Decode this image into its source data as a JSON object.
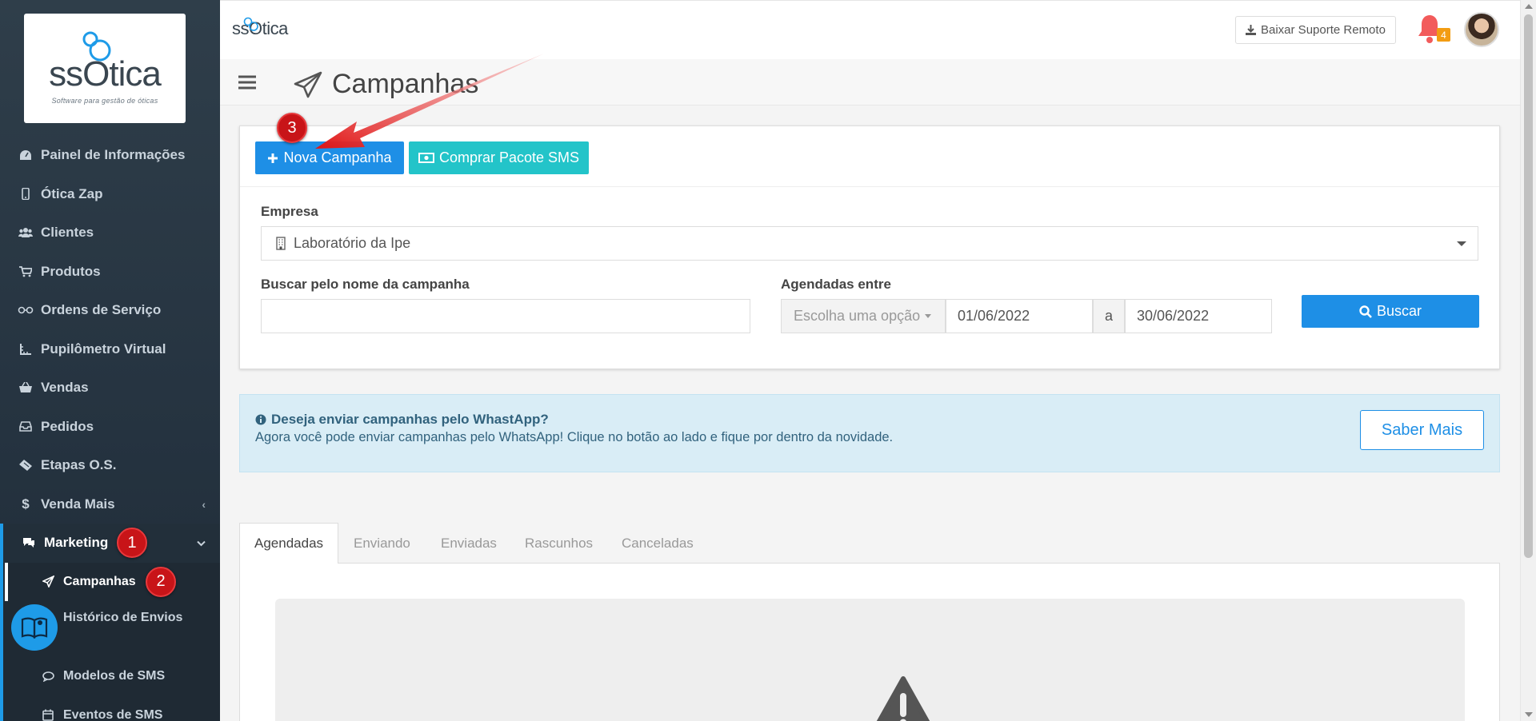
{
  "sidebar": {
    "logo_text": "ssOtica",
    "logo_tagline": "Software para gestão de óticas",
    "items": [
      {
        "label": "Painel de Informações",
        "icon": "dashboard-icon"
      },
      {
        "label": "Ótica Zap",
        "icon": "mobile-icon"
      },
      {
        "label": "Clientes",
        "icon": "users-icon"
      },
      {
        "label": "Produtos",
        "icon": "cart-icon"
      },
      {
        "label": "Ordens de Serviço",
        "icon": "glasses-icon"
      },
      {
        "label": "Pupilômetro Virtual",
        "icon": "ruler-icon"
      },
      {
        "label": "Vendas",
        "icon": "basket-icon"
      },
      {
        "label": "Pedidos",
        "icon": "inbox-icon"
      },
      {
        "label": "Etapas O.S.",
        "icon": "ticket-icon"
      },
      {
        "label": "Venda Mais",
        "icon": "dollar-icon"
      },
      {
        "label": "Marketing",
        "icon": "comments-icon"
      }
    ],
    "submenu": [
      {
        "label": "Campanhas",
        "icon": "paper-plane-icon"
      },
      {
        "label": "Histórico de Envios",
        "icon": "history-icon"
      },
      {
        "label": "Modelos de SMS",
        "icon": "comment-icon"
      },
      {
        "label": "Eventos de SMS",
        "icon": "calendar-icon"
      }
    ],
    "markers": {
      "marketing": "1",
      "campanhas": "2"
    }
  },
  "topbar": {
    "logo_text": "ssOtica",
    "remote_support_label": "Baixar Suporte Remoto",
    "notification_count": "4"
  },
  "page": {
    "title": "Campanhas",
    "marker_new": "3"
  },
  "filters": {
    "new_campaign_label": "Nova Campanha",
    "buy_sms_label": "Comprar Pacote SMS",
    "empresa_label": "Empresa",
    "empresa_value": "Laboratório da Ipe",
    "search_label": "Buscar pelo nome da campanha",
    "search_value": "",
    "scheduled_label": "Agendadas entre",
    "period_select": "Escolha uma opção",
    "date_from": "01/06/2022",
    "date_separator": "a",
    "date_to": "30/06/2022",
    "search_button": "Buscar"
  },
  "info": {
    "title": "Deseja enviar campanhas pelo WhastApp?",
    "text": "Agora você pode enviar campanhas pelo WhatsApp! Clique no botão ao lado e fique por dentro da novidade.",
    "button": "Saber Mais"
  },
  "tabs": [
    "Agendadas",
    "Enviando",
    "Enviadas",
    "Rascunhos",
    "Canceladas"
  ],
  "colors": {
    "primary": "#1e8fe6",
    "teal": "#23c4c9",
    "sidebar": "#2f3e4a",
    "marker_red": "#c81418",
    "info_bg": "#d9edf6"
  }
}
